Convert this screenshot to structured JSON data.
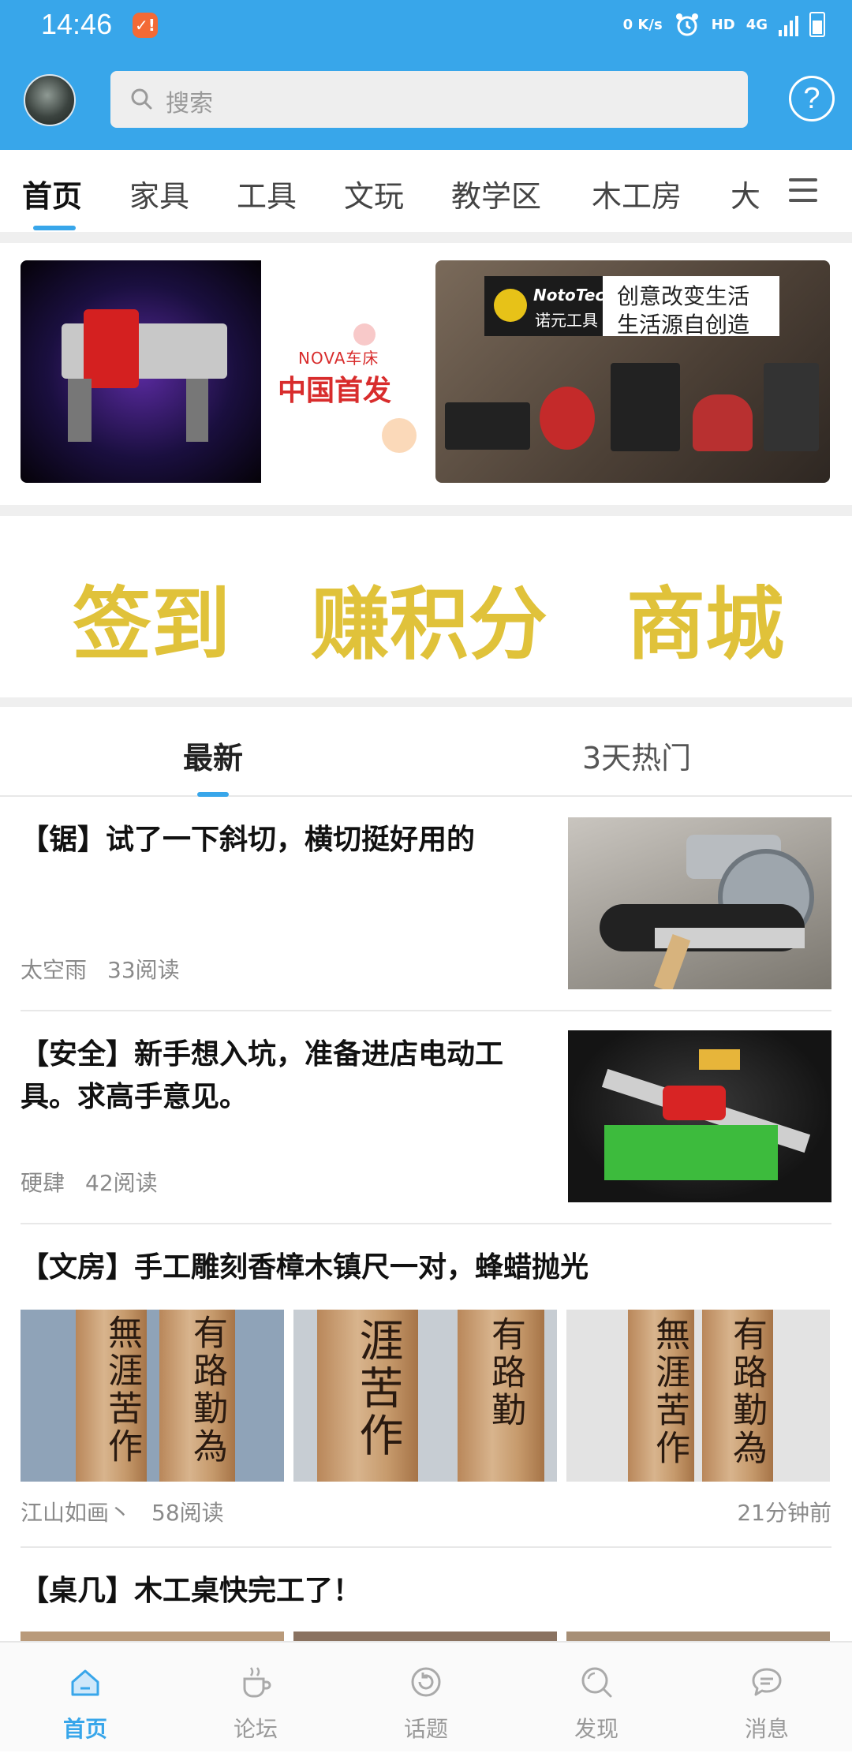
{
  "status_bar": {
    "time": "14:46",
    "notification_badge": "✓!",
    "network_speed": "0 K/s",
    "hd": "HD",
    "network": "4G"
  },
  "header": {
    "search_placeholder": "搜索",
    "help_icon": "?"
  },
  "category_tabs": [
    {
      "label": "首页",
      "active": true
    },
    {
      "label": "家具",
      "active": false
    },
    {
      "label": "工具",
      "active": false
    },
    {
      "label": "文玩",
      "active": false
    },
    {
      "label": "教学区",
      "active": false
    },
    {
      "label": "木工房",
      "active": false
    },
    {
      "label": "大",
      "active": false
    }
  ],
  "banners": {
    "left": {
      "brand": "NOVA车床",
      "headline": "中国首发"
    },
    "right": {
      "brand_line1": "NotoTec",
      "brand_line2": "诺元工具",
      "slogan_line1": "创意改变生活",
      "slogan_line2": "生活源自创造"
    }
  },
  "quick_actions": [
    {
      "label": "签到"
    },
    {
      "label": "赚积分"
    },
    {
      "label": "商城"
    }
  ],
  "feed_tabs": [
    {
      "label": "最新",
      "active": true
    },
    {
      "label": "3天热门",
      "active": false
    }
  ],
  "posts": [
    {
      "title": "【锯】试了一下斜切，横切挺好用的",
      "author": "太空雨",
      "reads": "33阅读"
    },
    {
      "title": "【安全】新手想入坑，准备进店电动工具。求高手意见。",
      "author": "硬肆",
      "reads": "42阅读"
    },
    {
      "title": "【文房】手工雕刻香樟木镇尺一对，蜂蜡抛光",
      "author": "江山如画丶",
      "reads": "58阅读",
      "time": "21分钟前"
    },
    {
      "title": "【桌几】木工桌快完工了！"
    }
  ],
  "bottom_nav": [
    {
      "label": "首页",
      "icon": "home-icon",
      "active": true
    },
    {
      "label": "论坛",
      "icon": "coffee-cup-icon",
      "active": false
    },
    {
      "label": "话题",
      "icon": "refresh-circle-icon",
      "active": false
    },
    {
      "label": "发现",
      "icon": "search-icon",
      "active": false
    },
    {
      "label": "消息",
      "icon": "chat-bubble-icon",
      "active": false
    }
  ],
  "colors": {
    "accent": "#38a6ea",
    "action_gold": "#e0c23a"
  }
}
